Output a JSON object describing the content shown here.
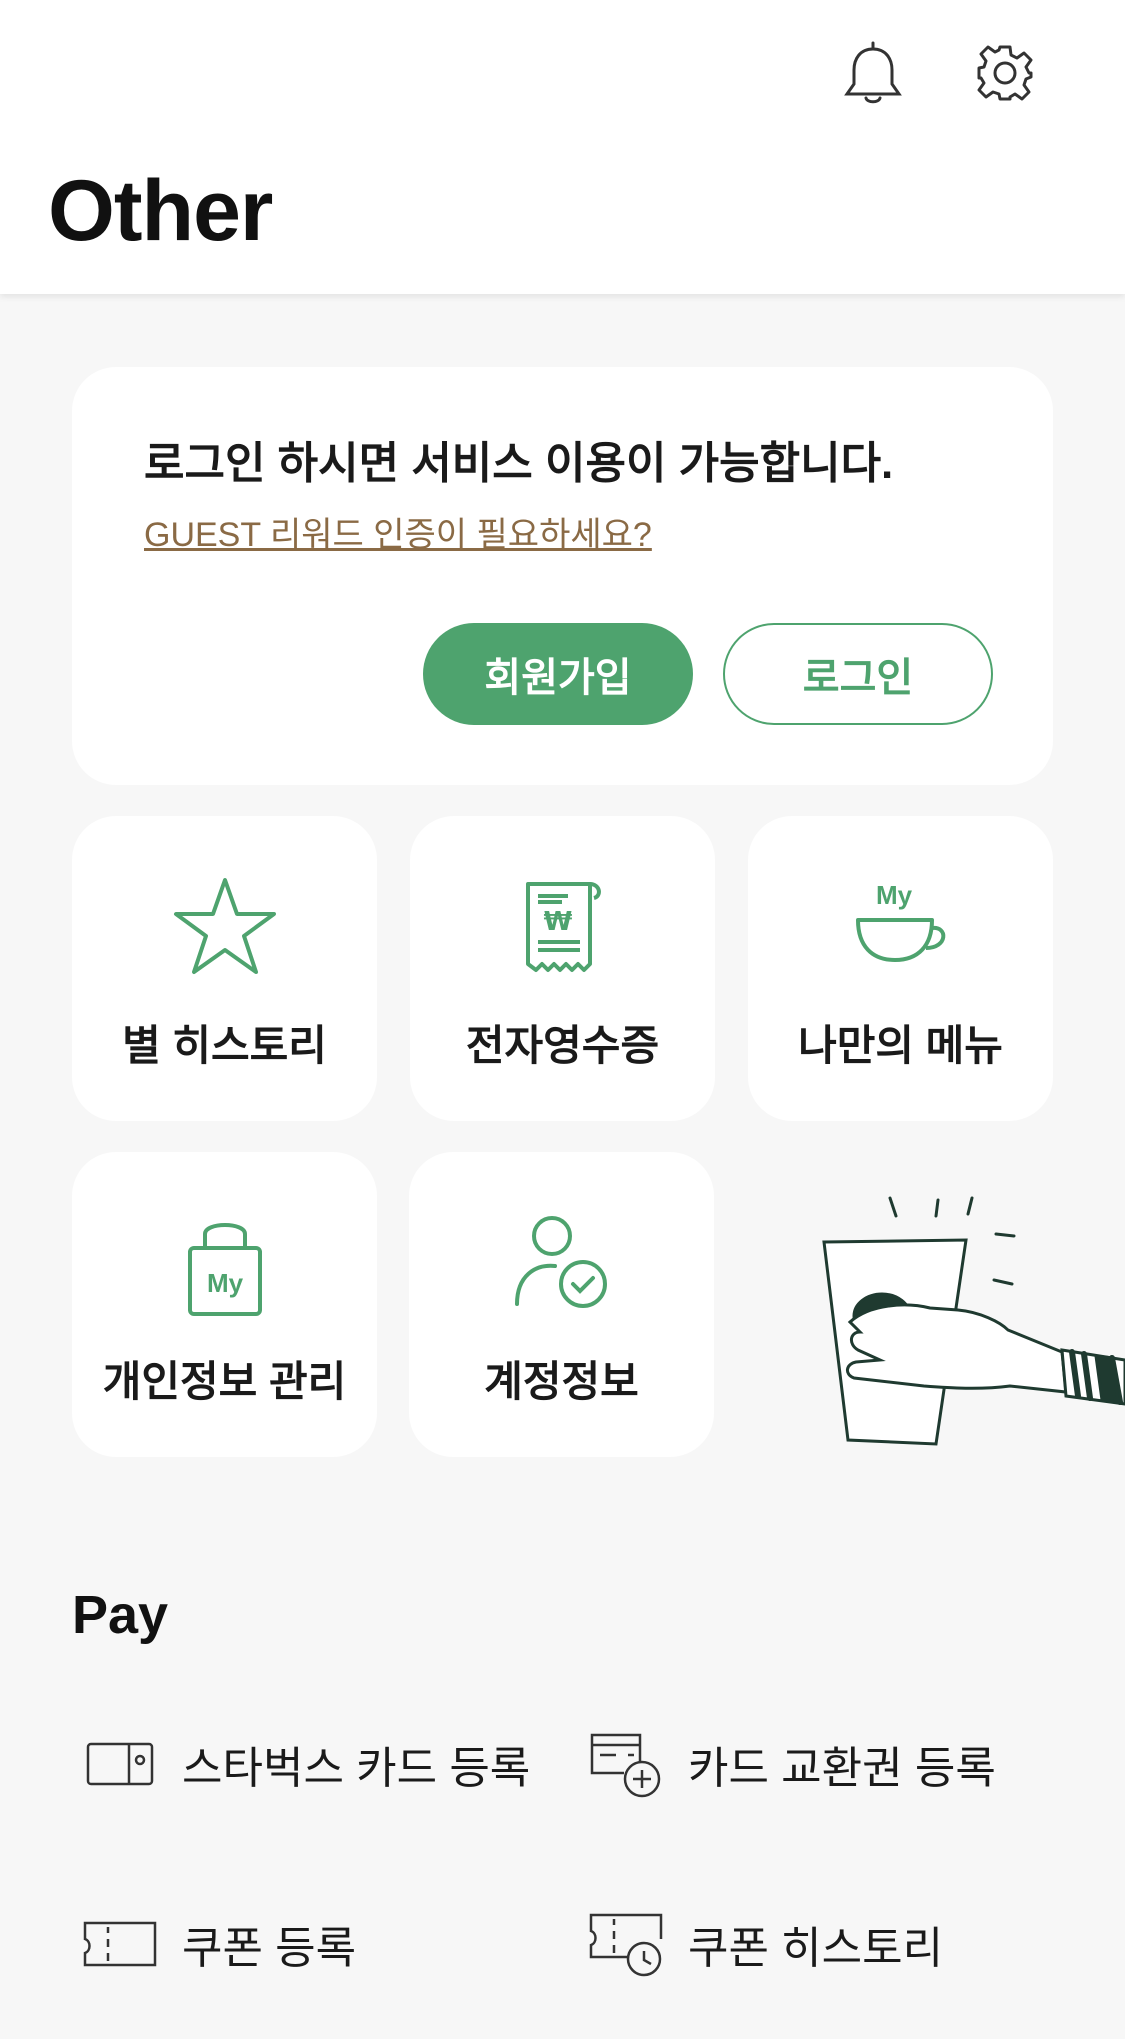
{
  "header": {
    "title": "Other"
  },
  "login_card": {
    "message": "로그인 하시면 서비스 이용이 가능합니다.",
    "guest_link": "GUEST 리워드 인증이 필요하세요?",
    "join_label": "회원가입",
    "login_label": "로그인"
  },
  "tiles": [
    {
      "label": "별 히스토리",
      "icon": "star-icon"
    },
    {
      "label": "전자영수증",
      "icon": "receipt-icon"
    },
    {
      "label": "나만의 메뉴",
      "icon": "my-cup-icon",
      "icon_text": "My"
    },
    {
      "label": "개인정보 관리",
      "icon": "my-lock-icon",
      "icon_text": "My"
    },
    {
      "label": "계정정보",
      "icon": "account-check-icon"
    }
  ],
  "pay": {
    "title": "Pay",
    "items": [
      {
        "label": "스타벅스 카드 등록",
        "icon": "card-icon"
      },
      {
        "label": "카드 교환권 등록",
        "icon": "card-add-icon"
      },
      {
        "label": "쿠폰 등록",
        "icon": "coupon-icon"
      },
      {
        "label": "쿠폰 히스토리",
        "icon": "coupon-history-icon"
      }
    ]
  },
  "colors": {
    "accent": "#4ea36e",
    "link": "#8a6a45",
    "background": "#f7f7f7"
  }
}
